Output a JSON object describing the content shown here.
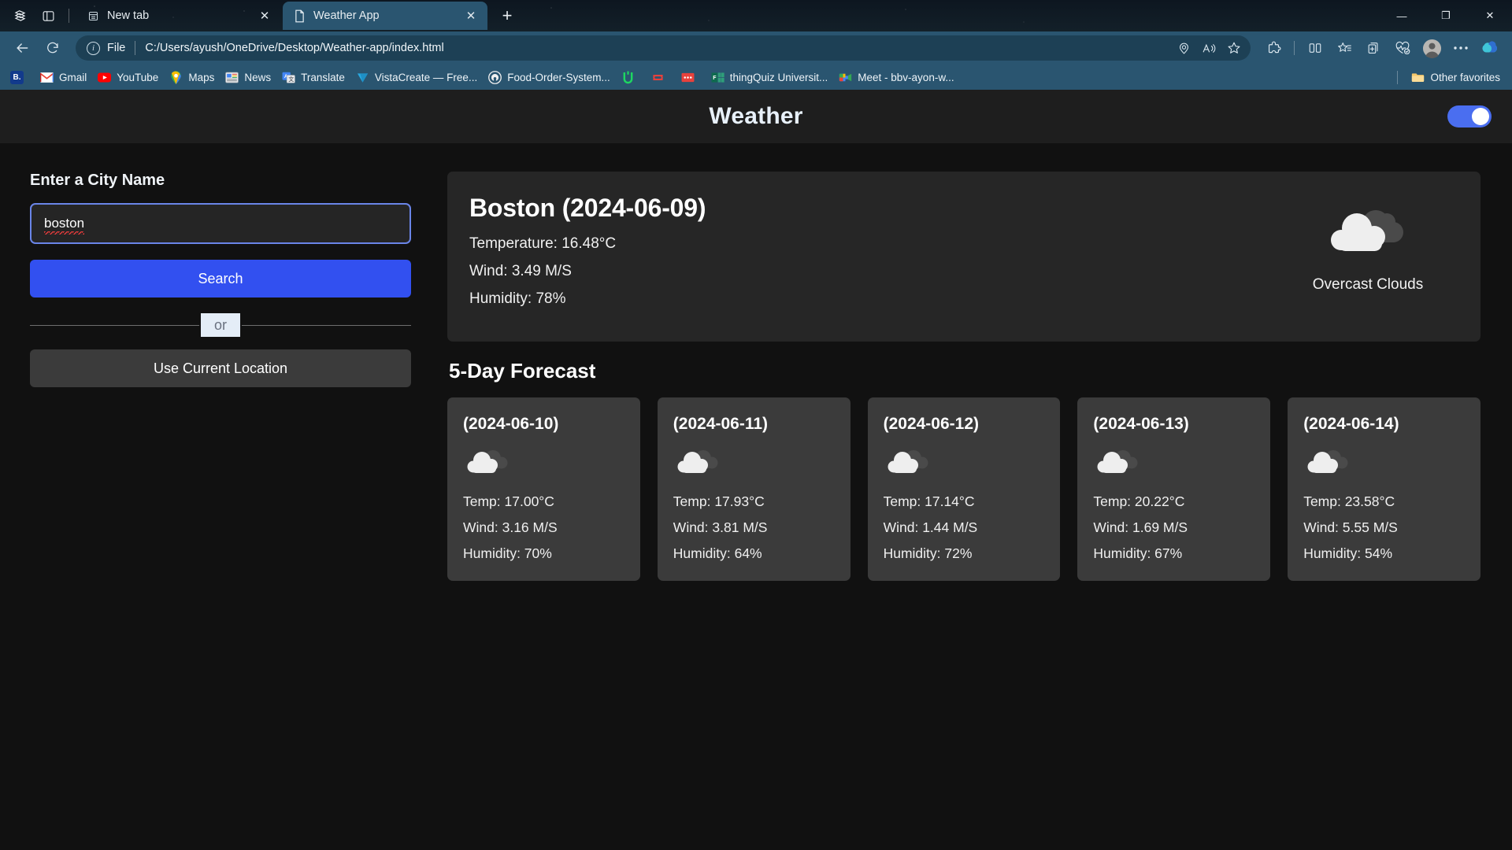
{
  "browser": {
    "tabs": [
      {
        "title": "New tab",
        "favicon": "window-icon",
        "active": false
      },
      {
        "title": "Weather App",
        "favicon": "document-icon",
        "active": true
      }
    ],
    "new_tab_label": "+",
    "window_controls": {
      "minimize": "—",
      "maximize": "❐",
      "close": "✕"
    },
    "toolbar": {
      "back": "back-arrow-icon",
      "refresh": "refresh-icon",
      "file_label": "File",
      "url": "C:/Users/ayush/OneDrive/Desktop/Weather-app/index.html",
      "omni_icons": [
        "location-pin-icon",
        "read-aloud-icon",
        "favorite-star-icon"
      ],
      "right_icons": [
        "extensions-icon",
        "split-screen-icon",
        "collections-star-icon",
        "add-favorites-icon",
        "browser-essentials-icon",
        "profile-avatar-icon",
        "settings-more-icon",
        "copilot-icon"
      ]
    },
    "bookmarks": [
      {
        "label": "",
        "icon": "booking-icon",
        "color": "#1a3a8f",
        "glyph": "B."
      },
      {
        "label": "Gmail",
        "icon": "gmail-icon",
        "color": "#ffffff",
        "glyph": "M"
      },
      {
        "label": "YouTube",
        "icon": "youtube-icon",
        "color": "#ff0000",
        "glyph": "▶"
      },
      {
        "label": "Maps",
        "icon": "google-maps-icon",
        "color": "#34a853",
        "glyph": "▼"
      },
      {
        "label": "News",
        "icon": "google-news-icon",
        "color": "#e8eaed",
        "glyph": "☷"
      },
      {
        "label": "Translate",
        "icon": "google-translate-icon",
        "color": "#4285f4",
        "glyph": "文"
      },
      {
        "label": "VistaCreate — Free...",
        "icon": "vistacreate-icon",
        "color": "#29a9e0",
        "glyph": "▼"
      },
      {
        "label": "Food-Order-System...",
        "icon": "github-icon",
        "color": "#f0f0f0",
        "glyph": "●"
      },
      {
        "label": "",
        "icon": "green-u-icon",
        "color": "#1ed760",
        "glyph": "U"
      },
      {
        "label": "",
        "icon": "red-link-icon",
        "color": "#e8413c",
        "glyph": "⇌"
      },
      {
        "label": "",
        "icon": "red-dots-icon",
        "color": "#e8413c",
        "glyph": "⋯"
      },
      {
        "label": "thingQuiz Universit...",
        "icon": "microsoft-forms-icon",
        "color": "#217346",
        "glyph": "F"
      },
      {
        "label": "Meet - bbv-ayon-w...",
        "icon": "google-meet-icon",
        "color": "#00832d",
        "glyph": "▶"
      }
    ],
    "other_favorites": {
      "label": "Other favorites",
      "icon": "folder-icon"
    }
  },
  "app": {
    "title": "Weather",
    "theme_toggle": {
      "name": "theme-toggle",
      "state": "on"
    },
    "sidebar": {
      "label": "Enter a City Name",
      "input_value": "boston",
      "input_placeholder": "Enter a City Name",
      "search_button": "Search",
      "or_text": "or",
      "location_button": "Use Current Location"
    },
    "current": {
      "city": "Boston",
      "date": "(2024-06-09)",
      "heading": "Boston (2024-06-09)",
      "temperature": "Temperature: 16.48°C",
      "wind": "Wind: 3.49 M/S",
      "humidity": "Humidity: 78%",
      "description": "Overcast Clouds",
      "icon": "overcast-clouds-icon"
    },
    "forecast": {
      "title": "5-Day Forecast",
      "days": [
        {
          "date": "(2024-06-10)",
          "icon": "clouds-icon",
          "temp": "Temp: 17.00°C",
          "wind": "Wind: 3.16 M/S",
          "humidity": "Humidity: 70%"
        },
        {
          "date": "(2024-06-11)",
          "icon": "clouds-icon",
          "temp": "Temp: 17.93°C",
          "wind": "Wind: 3.81 M/S",
          "humidity": "Humidity: 64%"
        },
        {
          "date": "(2024-06-12)",
          "icon": "clouds-icon",
          "temp": "Temp: 17.14°C",
          "wind": "Wind: 1.44 M/S",
          "humidity": "Humidity: 72%"
        },
        {
          "date": "(2024-06-13)",
          "icon": "clouds-icon",
          "temp": "Temp: 20.22°C",
          "wind": "Wind: 1.69 M/S",
          "humidity": "Humidity: 67%"
        },
        {
          "date": "(2024-06-14)",
          "icon": "clouds-icon",
          "temp": "Temp: 23.58°C",
          "wind": "Wind: 5.55 M/S",
          "humidity": "Humidity: 54%"
        }
      ]
    }
  },
  "colors": {
    "browser_chrome": "#2a5570",
    "tab_active": "#2a5570",
    "page_bg": "#111111",
    "header_bg": "#1e1e1e",
    "card_bg": "#262626",
    "forecast_card_bg": "#3b3b3b",
    "accent_blue": "#3250f0",
    "toggle_on": "#4a6ef0",
    "input_border": "#6a85e8"
  }
}
